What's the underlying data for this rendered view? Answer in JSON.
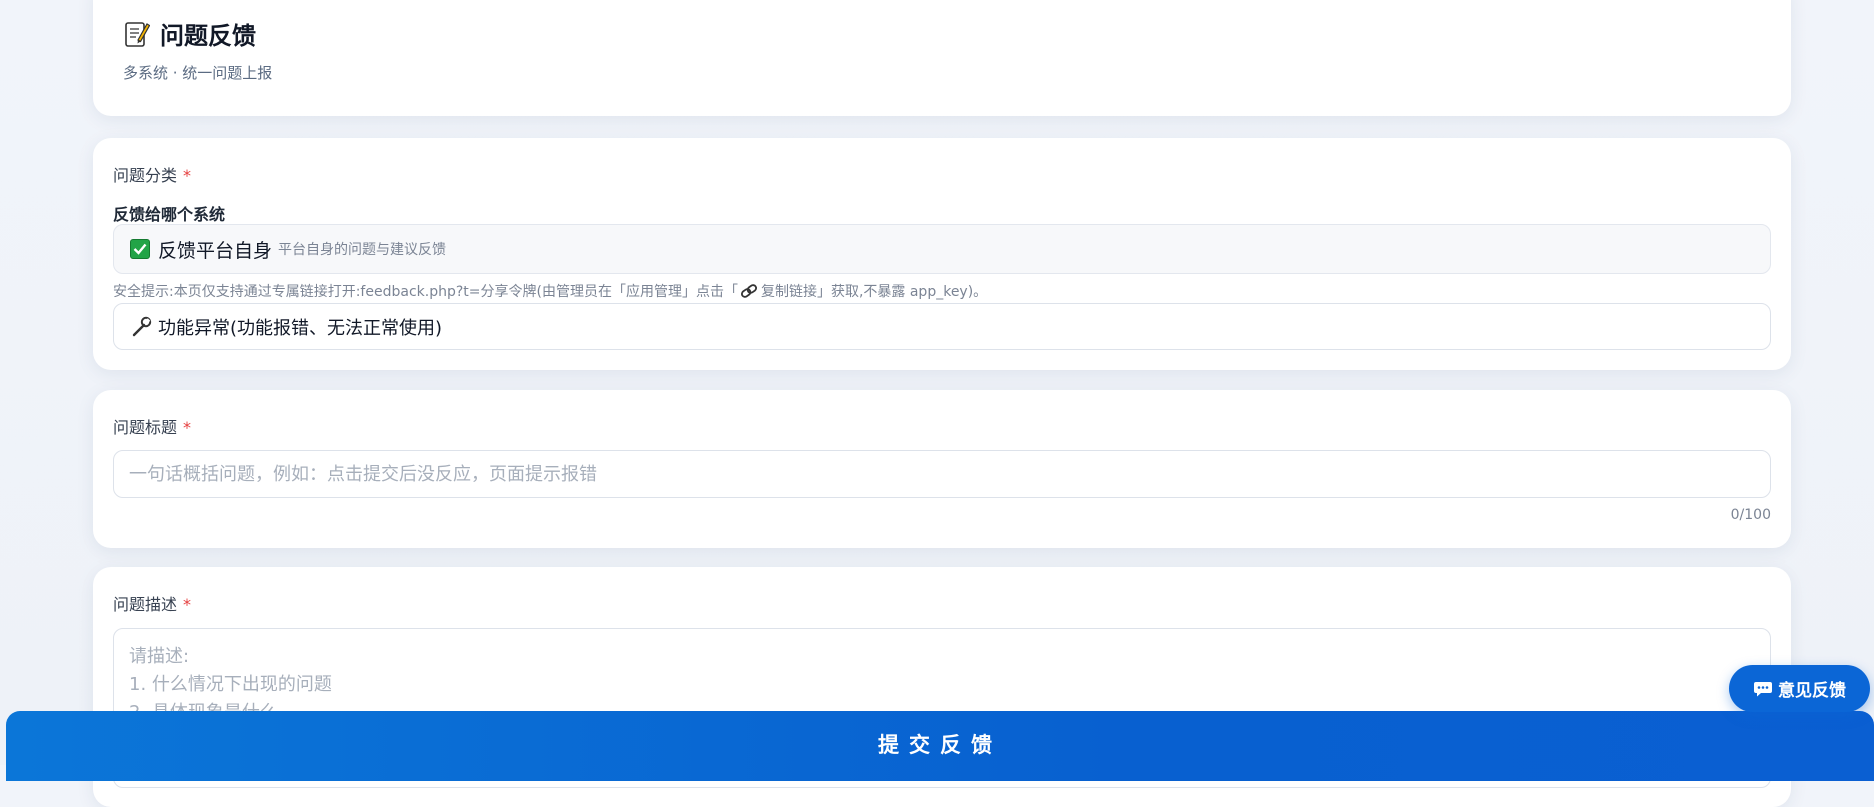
{
  "header": {
    "title": "问题反馈",
    "subtitle": "多系统 · 统一问题上报"
  },
  "category": {
    "label": "问题分类",
    "required_mark": "*",
    "system_label": "反馈给哪个系统",
    "system_select": {
      "value": "反馈平台自身",
      "description": "平台自身的问题与建议反馈"
    },
    "security_tip_before": "安全提示:本页仅支持通过专属链接打开:feedback.php?t=分享令牌(由管理员在「应用管理」点击「",
    "security_tip_after": "复制链接」获取,不暴露 app_key)。",
    "type_select": {
      "value": "功能异常(功能报错、无法正常使用)"
    }
  },
  "title_field": {
    "label": "问题标题",
    "required_mark": "*",
    "placeholder": "一句话概括问题，例如：点击提交后没反应，页面提示报错",
    "value": "",
    "counter": "0/100"
  },
  "description_field": {
    "label": "问题描述",
    "required_mark": "*",
    "placeholder": "请描述:\n1. 什么情况下出现的问题\n2. 具体现象是什么"
  },
  "submit": {
    "label": "提交反馈"
  },
  "floating_feedback": {
    "label": "意见反馈"
  },
  "icons": {
    "title": "memo-icon",
    "system_select": "check-mark-icon",
    "security_tip": "link-icon",
    "type_select": "wrench-icon",
    "floating_feedback": "chat-bubble-icon"
  },
  "colors": {
    "primary": "#0b66d6",
    "required": "#e53e3e",
    "check_green": "#22a447"
  }
}
